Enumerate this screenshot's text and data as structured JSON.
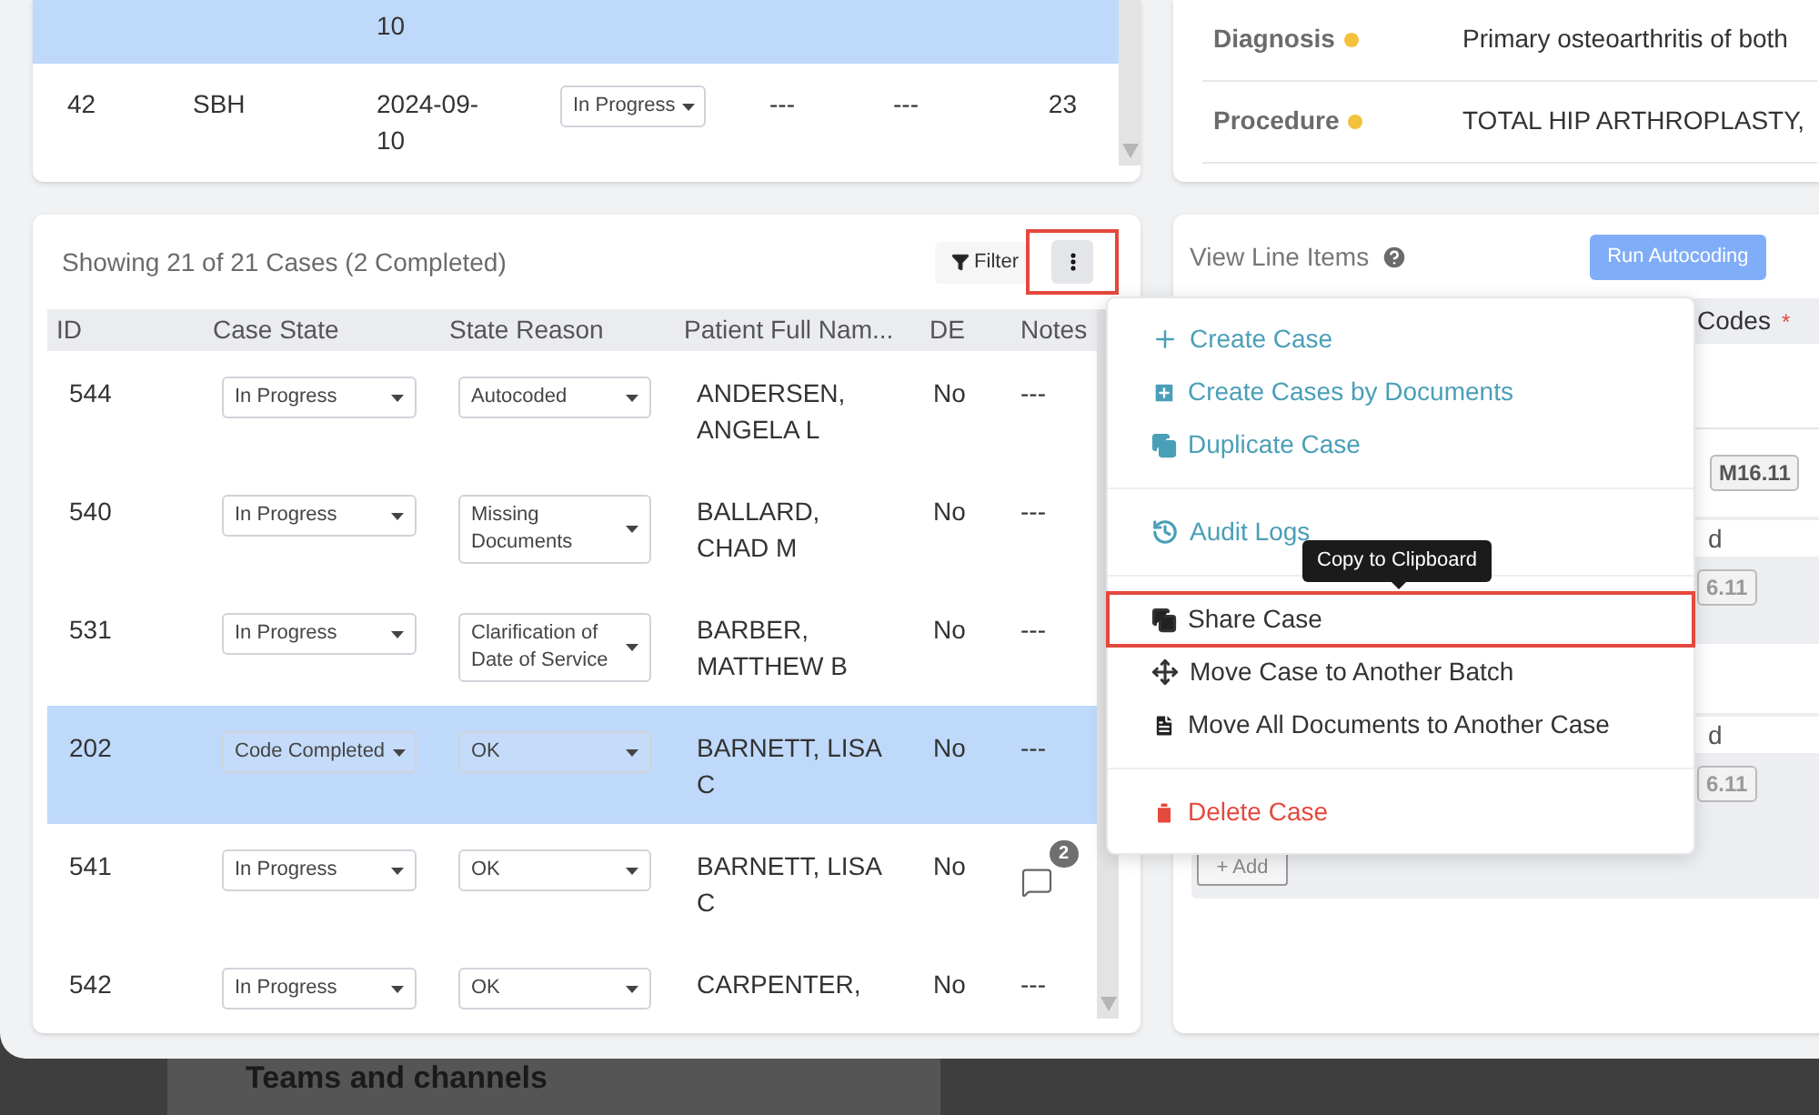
{
  "top_table": {
    "rows": [
      {
        "selected": true,
        "cells": [
          null,
          null,
          "10",
          null,
          null,
          null,
          null
        ]
      },
      {
        "selected": false,
        "cells": [
          "42",
          "SBH",
          "2024-09-10",
          "In Progress",
          "---",
          "---",
          "23"
        ]
      }
    ]
  },
  "case_summary": {
    "fields": [
      {
        "label": "Diagnosis",
        "color": "#f4c13d",
        "value": "Primary osteoarthritis of both"
      },
      {
        "label": "Procedure",
        "color": "#f4c13d",
        "value": "TOTAL HIP ARTHROPLASTY,"
      }
    ]
  },
  "cases": {
    "summary": "Showing 21 of 21 Cases (2 Completed)",
    "filter_button": "Filter",
    "more_button": {
      "annotated": true
    },
    "columns": [
      "ID",
      "Case State",
      "State Reason",
      "Patient Full Nam...",
      "DE",
      "Notes"
    ],
    "rows": [
      {
        "selected": false,
        "id": "544",
        "case_state": "In Progress",
        "state_reason": "Autocoded",
        "patient": "ANDERSEN, ANGELA L",
        "de": "No",
        "notes": "---"
      },
      {
        "selected": false,
        "id": "540",
        "case_state": "In Progress",
        "state_reason": "Missing Documents",
        "patient": "BALLARD, CHAD M",
        "de": "No",
        "notes": "---"
      },
      {
        "selected": false,
        "id": "531",
        "case_state": "In Progress",
        "state_reason": "Clarification of Date of Service",
        "patient": "BARBER, MATTHEW B",
        "de": "No",
        "notes": "---"
      },
      {
        "selected": true,
        "id": "202",
        "case_state": "Code Completed",
        "state_reason": "OK",
        "patient": "BARNETT, LISA C",
        "de": "No",
        "notes": "---"
      },
      {
        "selected": false,
        "id": "541",
        "case_state": "In Progress",
        "state_reason": "OK",
        "patient": "BARNETT, LISA C",
        "de": "No",
        "comment_count": "2"
      },
      {
        "selected": false,
        "id": "542",
        "case_state": "In Progress",
        "state_reason": "OK",
        "patient": "CARPENTER,",
        "de": "No",
        "notes": "---"
      }
    ]
  },
  "line_items": {
    "title": "View Line Items",
    "run_button": "Run Autocoding",
    "codes_header": "Codes",
    "required_mark": "*",
    "code_badge": "M16.11",
    "groups": [
      {
        "field_tail": "d",
        "badge_tail": "6.11"
      },
      {
        "field_tail": "d",
        "badge_tail": "6.11",
        "add_button": "+ Add"
      }
    ]
  },
  "menu": {
    "groups": [
      {
        "items": [
          {
            "label": "Create Case",
            "kind": "action",
            "annotated": false
          },
          {
            "label": "Create Cases by Documents",
            "kind": "action",
            "annotated": false
          },
          {
            "label": "Duplicate Case",
            "kind": "action",
            "annotated": false
          }
        ]
      },
      {
        "items": [
          {
            "label": "Audit Logs",
            "kind": "action",
            "annotated": false
          }
        ]
      },
      {
        "items": [
          {
            "label": "Share Case",
            "kind": "default",
            "annotated": true
          },
          {
            "label": "Move Case to Another Batch",
            "kind": "default",
            "annotated": false
          },
          {
            "label": "Move All Documents to Another Case",
            "kind": "default",
            "annotated": false
          }
        ]
      },
      {
        "items": [
          {
            "label": "Delete Case",
            "kind": "danger",
            "annotated": false
          }
        ]
      }
    ]
  },
  "tooltip": "Copy to Clipboard",
  "background_window": {
    "heading": "Teams and channels"
  }
}
